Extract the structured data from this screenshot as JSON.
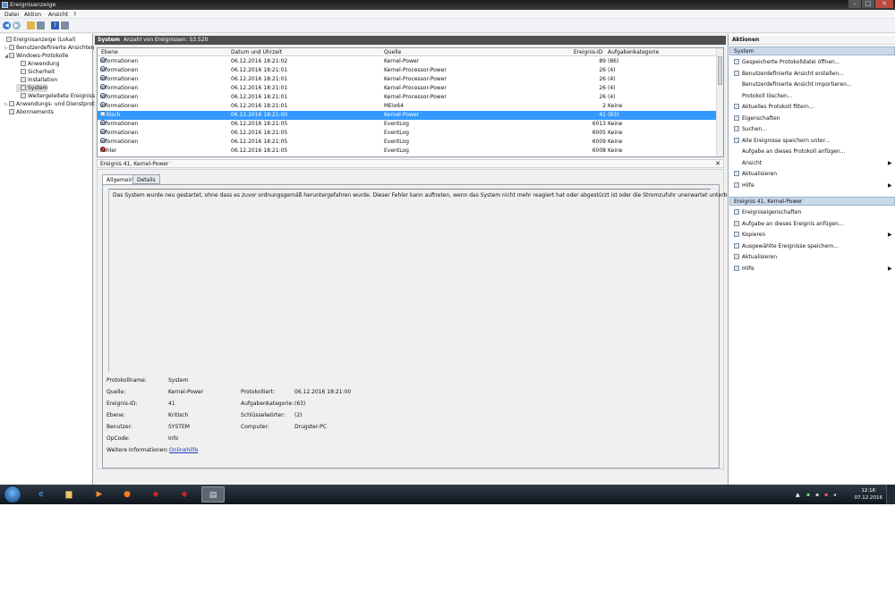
{
  "window": {
    "title": "Ereignisanzeige"
  },
  "menu": [
    "Datei",
    "Aktion",
    "Ansicht",
    "?"
  ],
  "tree": [
    {
      "label": "Ereignisanzeige (Lokal)",
      "expander": ""
    },
    {
      "label": "Benutzerdefinierte Ansichten",
      "expander": "▷"
    },
    {
      "label": "Windows-Protokolle",
      "expander": "◢"
    },
    {
      "label": "Anwendung",
      "expander": ""
    },
    {
      "label": "Sicherheit",
      "expander": ""
    },
    {
      "label": "Installation",
      "expander": ""
    },
    {
      "label": "System",
      "expander": ""
    },
    {
      "label": "Weitergeleitete Ereignisse",
      "expander": ""
    },
    {
      "label": "Anwendungs- und Dienstprotokolle",
      "expander": "▷"
    },
    {
      "label": "Abonnements",
      "expander": ""
    }
  ],
  "pane": {
    "name": "System",
    "count_label": "Anzahl von Ereignissen: 53.520"
  },
  "columns": {
    "level": "Ebene",
    "datetime": "Datum und Uhrzeit",
    "source": "Quelle",
    "event_id": "Ereignis-ID",
    "category": "Aufgabenkategorie"
  },
  "events": [
    {
      "level": "Informationen",
      "datetime": "06.12.2016 18:21:02",
      "source": "Kernel-Power",
      "id": "89",
      "category": "(86)"
    },
    {
      "level": "Informationen",
      "datetime": "06.12.2016 18:21:01",
      "source": "Kernel-Processor-Power",
      "id": "26",
      "category": "(4)"
    },
    {
      "level": "Informationen",
      "datetime": "06.12.2016 18:21:01",
      "source": "Kernel-Processor-Power",
      "id": "26",
      "category": "(4)"
    },
    {
      "level": "Informationen",
      "datetime": "06.12.2016 18:21:01",
      "source": "Kernel-Processor-Power",
      "id": "26",
      "category": "(4)"
    },
    {
      "level": "Informationen",
      "datetime": "06.12.2016 18:21:01",
      "source": "Kernel-Processor-Power",
      "id": "26",
      "category": "(4)"
    },
    {
      "level": "Informationen",
      "datetime": "06.12.2016 18:21:01",
      "source": "MEIx64",
      "id": "2",
      "category": "Keine"
    },
    {
      "level": "Kritisch",
      "datetime": "06.12.2016 18:21:00",
      "source": "Kernel-Power",
      "id": "41",
      "category": "(63)"
    },
    {
      "level": "Informationen",
      "datetime": "06.12.2016 18:21:05",
      "source": "EventLog",
      "id": "6013",
      "category": "Keine"
    },
    {
      "level": "Informationen",
      "datetime": "06.12.2016 18:21:05",
      "source": "EventLog",
      "id": "6005",
      "category": "Keine"
    },
    {
      "level": "Informationen",
      "datetime": "06.12.2016 18:21:05",
      "source": "EventLog",
      "id": "6009",
      "category": "Keine"
    },
    {
      "level": "Fehler",
      "datetime": "06.12.2016 18:21:05",
      "source": "EventLog",
      "id": "6008",
      "category": "Keine"
    }
  ],
  "detail": {
    "title": "Ereignis 41, Kernel-Power",
    "tab_general": "Allgemein",
    "tab_details": "Details",
    "message": "Das System wurde neu gestartet, ohne dass es zuvor ordnungsgemäß heruntergefahren wurde. Dieser Fehler kann auftreten, wenn das System nicht mehr reagiert hat oder abgestürzt ist oder die Stromzufuhr unerwartet unterbrochen wurde.",
    "labels": {
      "log_name": "Protokollname:",
      "source": "Quelle:",
      "event_id": "Ereignis-ID:",
      "level": "Ebene:",
      "user": "Benutzer:",
      "opcode": "OpCode:",
      "more_info": "Weitere Informationen:",
      "logged": "Protokolliert:",
      "task_category": "Aufgabenkategorie:",
      "keywords": "Schlüsselwörter:",
      "computer": "Computer:"
    },
    "values": {
      "log_name": "System",
      "source": "Kernel-Power",
      "event_id": "41",
      "level": "Kritisch",
      "user": "SYSTEM",
      "opcode": "Info",
      "more_info": "Onlinehilfe",
      "logged": "06.12.2016 18:21:00",
      "task_category": "(63)",
      "keywords": "(2)",
      "computer": "Drugster-PC"
    }
  },
  "actions": {
    "title": "Aktionen",
    "section1": "System",
    "items1": [
      {
        "label": "Gespeicherte Protokolldatei öffnen...",
        "icon": "folder-icon",
        "arrow": ""
      },
      {
        "label": "Benutzerdefinierte Ansicht erstellen...",
        "icon": "filter-icon",
        "arrow": ""
      },
      {
        "label": "Benutzerdefinierte Ansicht importieren...",
        "icon": "",
        "arrow": ""
      },
      {
        "label": "Protokoll löschen...",
        "icon": "",
        "arrow": ""
      },
      {
        "label": "Aktuelles Protokoll filtern...",
        "icon": "filter-icon",
        "arrow": ""
      },
      {
        "label": "Eigenschaften",
        "icon": "properties-icon",
        "arrow": ""
      },
      {
        "label": "Suchen...",
        "icon": "find-icon",
        "arrow": ""
      },
      {
        "label": "Alle Ereignisse speichern unter...",
        "icon": "save-icon",
        "arrow": ""
      },
      {
        "label": "Aufgabe an dieses Protokoll anfügen...",
        "icon": "",
        "arrow": ""
      },
      {
        "label": "Ansicht",
        "icon": "",
        "arrow": "▶"
      },
      {
        "label": "Aktualisieren",
        "icon": "refresh-icon",
        "arrow": ""
      },
      {
        "label": "Hilfe",
        "icon": "help-icon",
        "arrow": "▶"
      }
    ],
    "section2": "Ereignis 41, Kernel-Power",
    "items2": [
      {
        "label": "Ereigniseigenschaften",
        "icon": "event-properties-icon",
        "arrow": ""
      },
      {
        "label": "Aufgabe an dieses Ereignis anfügen...",
        "icon": "task-icon",
        "arrow": ""
      },
      {
        "label": "Kopieren",
        "icon": "copy-icon",
        "arrow": "▶"
      },
      {
        "label": "Ausgewählte Ereignisse speichern...",
        "icon": "save-icon",
        "arrow": ""
      },
      {
        "label": "Aktualisieren",
        "icon": "refresh-icon",
        "arrow": ""
      },
      {
        "label": "Hilfe",
        "icon": "help-icon",
        "arrow": "▶"
      }
    ]
  },
  "taskbar": {
    "time": "12:16",
    "date": "07.12.2016"
  },
  "colors": {
    "selection": "#3399ff",
    "pane_header": "#4f4f4f",
    "section": "#cad9ea",
    "critical": "#d82c2c",
    "link": "#1a3fb5"
  }
}
